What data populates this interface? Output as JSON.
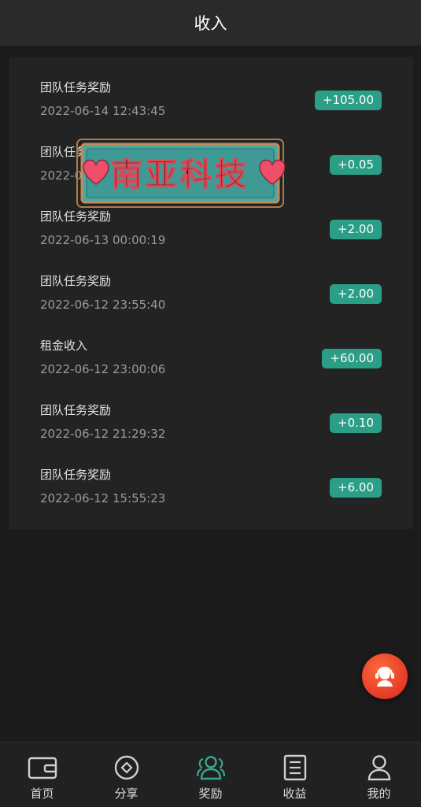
{
  "header": {
    "title": "收入"
  },
  "records": [
    {
      "name": "团队任务奖励",
      "time": "2022-06-14 12:43:45",
      "amount": "+105.00"
    },
    {
      "name": "团队任务奖励",
      "time": "2022-06-13 ...",
      "amount": "+0.05"
    },
    {
      "name": "团队任务奖励",
      "time": "2022-06-13 00:00:19",
      "amount": "+2.00"
    },
    {
      "name": "团队任务奖励",
      "time": "2022-06-12 23:55:40",
      "amount": "+2.00"
    },
    {
      "name": "租金收入",
      "time": "2022-06-12 23:00:06",
      "amount": "+60.00"
    },
    {
      "name": "团队任务奖励",
      "time": "2022-06-12 21:29:32",
      "amount": "+0.10"
    },
    {
      "name": "团队任务奖励",
      "time": "2022-06-12 15:55:23",
      "amount": "+6.00"
    }
  ],
  "watermark": {
    "text": "南亚科技"
  },
  "tabs": [
    {
      "label": "首页",
      "icon": "wallet-icon"
    },
    {
      "label": "分享",
      "icon": "diamond-circle-icon"
    },
    {
      "label": "奖励",
      "icon": "users-icon",
      "active": true
    },
    {
      "label": "收益",
      "icon": "document-icon"
    },
    {
      "label": "我的",
      "icon": "user-icon"
    }
  ],
  "colors": {
    "accent": "#2a9e86",
    "support": "#e0341f"
  }
}
